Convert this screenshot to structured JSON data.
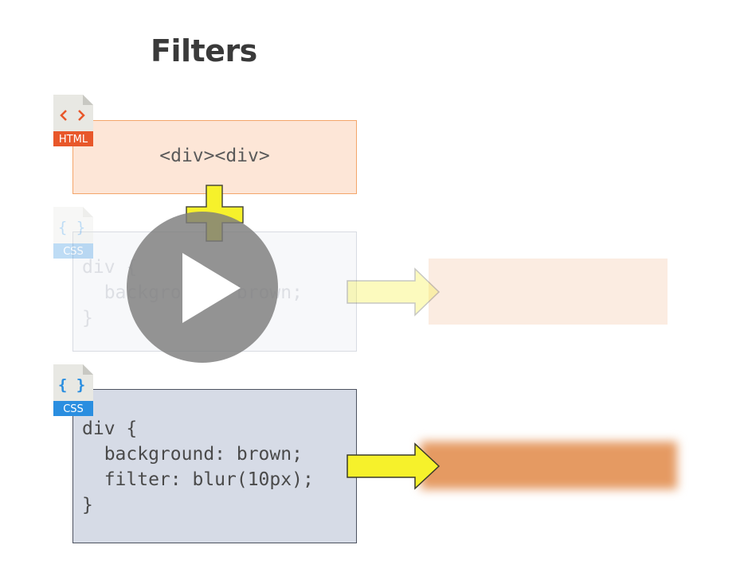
{
  "slide": {
    "title": "Filters"
  },
  "html_box": {
    "badge": "HTML",
    "code": "<div><div>"
  },
  "css_box_faded": {
    "badge": "CSS",
    "code": "div {\n  background: brown;\n}"
  },
  "css_box": {
    "badge": "CSS",
    "code": "div {\n  background: brown;\n  filter: blur(10px);\n}"
  },
  "icons": {
    "html_file": "html-file-icon",
    "css_file": "css-file-icon",
    "plus": "plus-icon",
    "arrow": "arrow-right-icon",
    "play": "play-icon"
  },
  "colors": {
    "html_accent": "#e8572a",
    "css_accent": "#2a8ee0",
    "brown_result": "#e59a62",
    "yellow": "#f6f12b"
  }
}
